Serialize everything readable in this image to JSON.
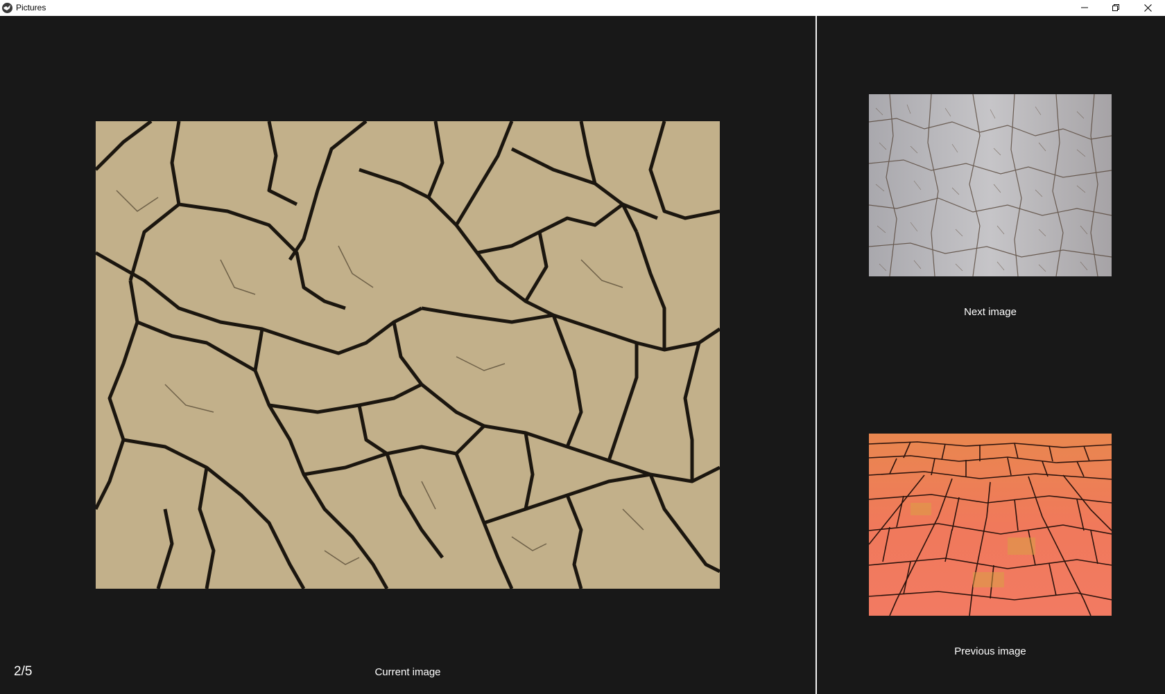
{
  "window": {
    "title": "Pictures",
    "app_icon": "bird-logo-icon",
    "controls": {
      "minimize_icon": "minimize-icon",
      "restore_icon": "restore-icon",
      "close_icon": "close-icon"
    }
  },
  "viewer": {
    "counter": "2/5",
    "current_caption": "Current image",
    "next_caption": "Next image",
    "previous_caption": "Previous image"
  },
  "colors": {
    "background": "#181818",
    "divider": "#f2f2f2",
    "text": "#ffffff",
    "current_image_tone": "#c2b08a",
    "next_image_tone": "#b3b1b3",
    "previous_image_tone": "#f07a58"
  }
}
